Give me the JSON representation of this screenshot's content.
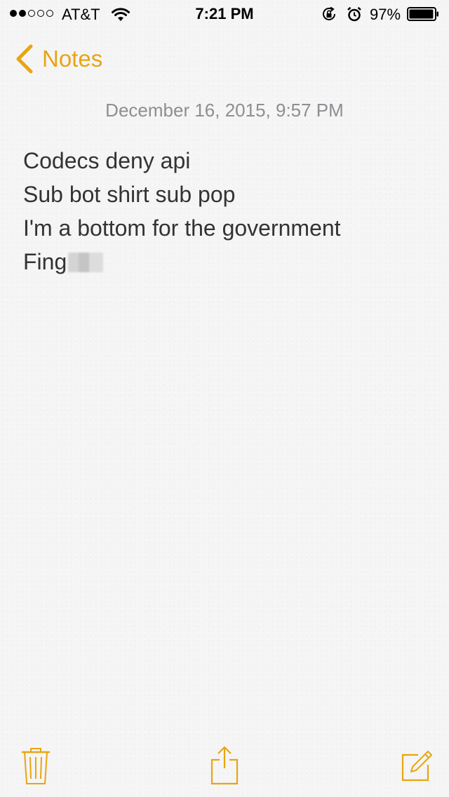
{
  "status_bar": {
    "signal_bars_filled": 2,
    "signal_bars_total": 5,
    "carrier": "AT&T",
    "time": "7:21 PM",
    "battery_percent": "97%",
    "battery_level": 0.97,
    "icons": [
      "wifi-icon",
      "rotation-lock-icon",
      "alarm-icon",
      "battery-icon"
    ]
  },
  "nav": {
    "back_label": "Notes"
  },
  "note": {
    "date": "December 16, 2015, 9:57 PM",
    "lines": [
      "Codecs deny api",
      "Sub bot shirt sub pop",
      "I'm a bottom for the government",
      "Fing"
    ]
  },
  "toolbar": {
    "icons": [
      "trash-icon",
      "share-icon",
      "compose-icon"
    ]
  },
  "colors": {
    "accent": "#e8a512",
    "date_text": "#8e8e93",
    "body_text": "#333333",
    "background": "#f5f5f5"
  }
}
